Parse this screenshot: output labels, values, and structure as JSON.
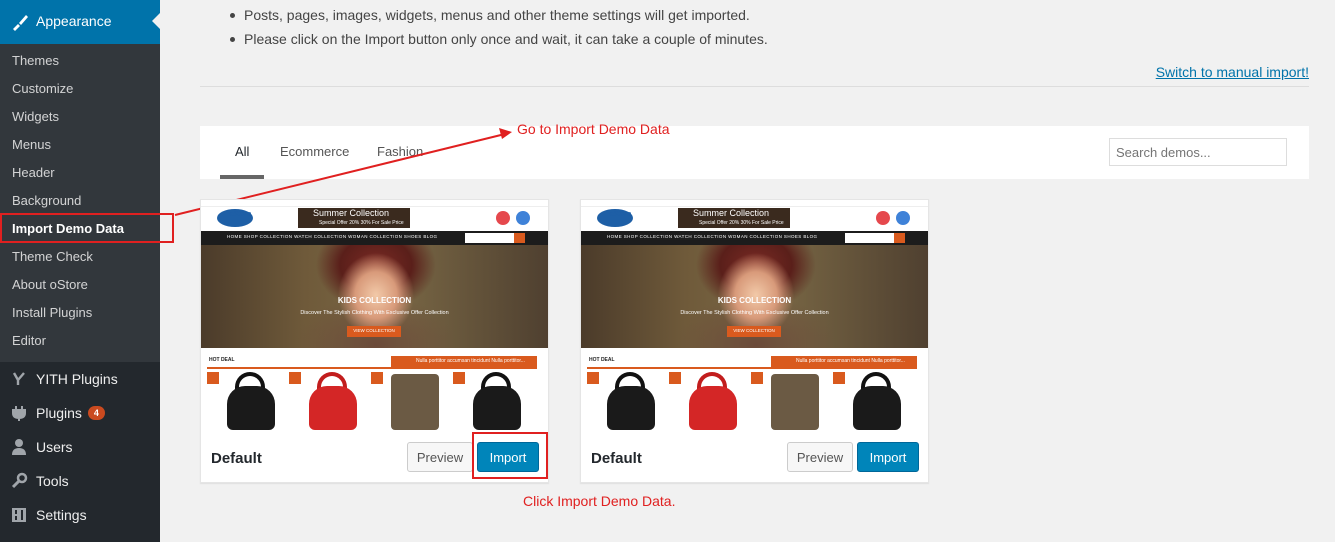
{
  "sidebar": {
    "active_menu": "Appearance",
    "submenu": [
      {
        "label": "Themes"
      },
      {
        "label": "Customize"
      },
      {
        "label": "Widgets"
      },
      {
        "label": "Menus"
      },
      {
        "label": "Header"
      },
      {
        "label": "Background"
      },
      {
        "label": "Import Demo Data",
        "current": true
      },
      {
        "label": "Theme Check"
      },
      {
        "label": "About oStore"
      },
      {
        "label": "Install Plugins"
      },
      {
        "label": "Editor"
      }
    ],
    "menu": [
      {
        "label": "YITH Plugins",
        "icon": "yith-icon"
      },
      {
        "label": "Plugins",
        "icon": "plugin-icon",
        "badge": "4"
      },
      {
        "label": "Users",
        "icon": "users-icon"
      },
      {
        "label": "Tools",
        "icon": "wrench-icon"
      },
      {
        "label": "Settings",
        "icon": "settings-icon"
      }
    ]
  },
  "notes": [
    "Posts, pages, images, widgets, menus and other theme settings will get imported.",
    "Please click on the Import button only once and wait, it can take a couple of minutes."
  ],
  "switch_link": "Switch to manual import!",
  "filter": {
    "tabs": [
      "All",
      "Ecommerce",
      "Fashion"
    ],
    "active_tab": "All",
    "search_placeholder": "Search demos..."
  },
  "annotations": {
    "go_to": "Go to Import Demo Data",
    "click_import": "Click Import Demo Data."
  },
  "demos": [
    {
      "name": "Default",
      "preview_label": "Preview",
      "import_label": "Import",
      "screenshot": {
        "logo": "oStore",
        "banner_title": "Summer Collection",
        "banner_subtitle": "Special Offer 20% 30% For Sale Price",
        "nav": "HOME   SHOP   COLLECTION   WATCH COLLECTION   WOMAN COLLECTION   SHOES   BLOG",
        "hero_title": "KIDS COLLECTION",
        "hero_subtitle": "Discover The Stylish Clothing With Exclusive Offer Collection",
        "hero_button": "VIEW COLLECTION",
        "deal_label": "HOT DEAL",
        "deal_ticker": "Nulla porttitor accumsan tincidunt Nulla porttitor..."
      }
    },
    {
      "name": "Default",
      "preview_label": "Preview",
      "import_label": "Import",
      "screenshot": {
        "logo": "oStore",
        "banner_title": "Summer Collection",
        "banner_subtitle": "Special Offer 20% 30% For Sale Price",
        "nav": "HOME   SHOP   COLLECTION   WATCH COLLECTION   WOMAN COLLECTION   SHOES   BLOG",
        "hero_title": "KIDS COLLECTION",
        "hero_subtitle": "Discover The Stylish Clothing With Exclusive Offer Collection",
        "hero_button": "VIEW COLLECTION",
        "deal_label": "HOT DEAL",
        "deal_ticker": "Nulla porttitor accumsan tincidunt Nulla porttitor..."
      }
    }
  ],
  "colors": {
    "sidebar_bg": "#23282d",
    "active_menu_bg": "#0073aa",
    "annotation_red": "#e02020",
    "primary_button": "#0085ba"
  }
}
